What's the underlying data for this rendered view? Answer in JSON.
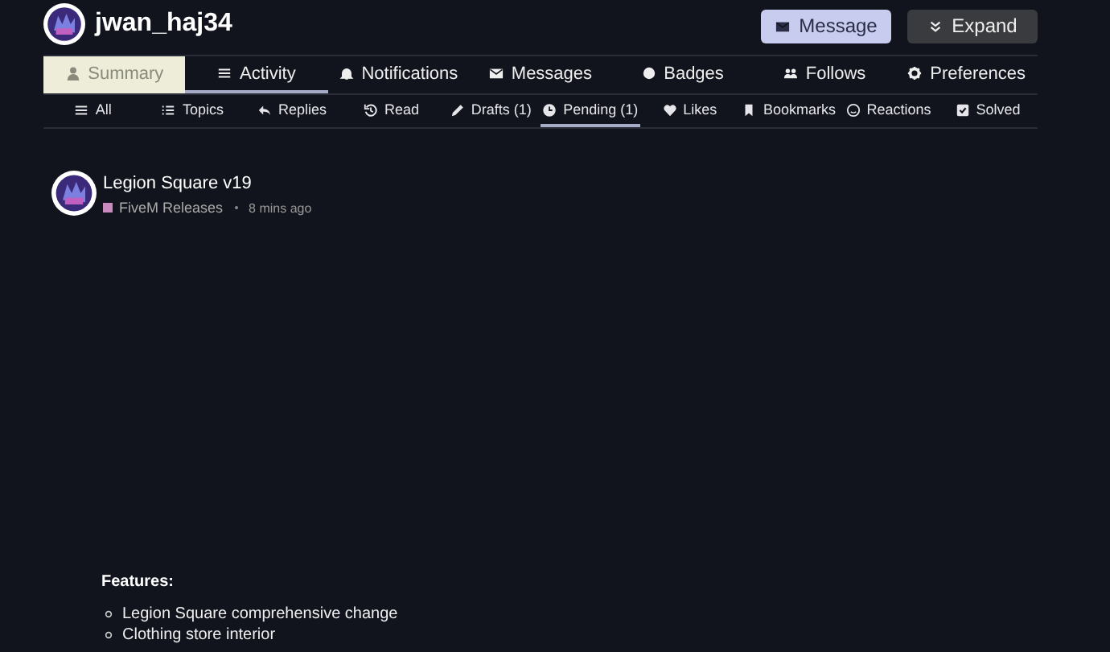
{
  "user": {
    "username": "jwan_haj34"
  },
  "actions": [
    {
      "label": "Message",
      "kind": "primary"
    },
    {
      "label": "Expand",
      "kind": "secondary"
    }
  ],
  "main_tabs": [
    {
      "label": "Summary",
      "selected": false,
      "highlighted": true
    },
    {
      "label": "Activity",
      "selected": true,
      "highlighted": false
    },
    {
      "label": "Notifications",
      "selected": false,
      "highlighted": false
    },
    {
      "label": "Messages",
      "selected": false,
      "highlighted": false
    },
    {
      "label": "Badges",
      "selected": false,
      "highlighted": false
    },
    {
      "label": "Follows",
      "selected": false,
      "highlighted": false
    },
    {
      "label": "Preferences",
      "selected": false,
      "highlighted": false
    }
  ],
  "sub_tabs": [
    {
      "label": "All",
      "selected": false
    },
    {
      "label": "Topics",
      "selected": false
    },
    {
      "label": "Replies",
      "selected": false
    },
    {
      "label": "Read",
      "selected": false
    },
    {
      "label": "Drafts (1)",
      "selected": false
    },
    {
      "label": "Pending (1)",
      "selected": true
    },
    {
      "label": "Likes",
      "selected": false
    },
    {
      "label": "Bookmarks",
      "selected": false
    },
    {
      "label": "Reactions",
      "selected": false
    },
    {
      "label": "Solved",
      "selected": false
    }
  ],
  "post": {
    "title": "Legion Square v19",
    "category": {
      "name": "FiveM Releases",
      "color": "#c98bbd"
    },
    "time": "8 mins ago",
    "heading": "Features:",
    "items": [
      "Legion Square comprehensive change",
      "Clothing store interior"
    ]
  }
}
